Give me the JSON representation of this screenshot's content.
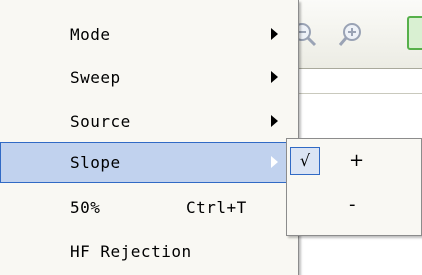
{
  "menu": {
    "items": [
      {
        "label": "Mode",
        "shortcut": "",
        "has_submenu": true
      },
      {
        "label": "Sweep",
        "shortcut": "",
        "has_submenu": true
      },
      {
        "label": "Source",
        "shortcut": "",
        "has_submenu": true
      },
      {
        "label": "Slope",
        "shortcut": "",
        "has_submenu": true,
        "highlighted": true
      },
      {
        "label": "50%",
        "shortcut": "Ctrl+T",
        "has_submenu": false
      },
      {
        "label": "HF Rejection",
        "shortcut": "",
        "has_submenu": false
      }
    ]
  },
  "submenu": {
    "items": [
      {
        "label": "+",
        "checked": true,
        "check_glyph": "√"
      },
      {
        "label": "-",
        "checked": false,
        "check_glyph": ""
      }
    ]
  },
  "toolbar": {
    "icons": [
      "zoom-out-icon",
      "zoom-in-icon",
      "green-button-icon"
    ]
  },
  "colors": {
    "highlight_bg": "#c1d2ee",
    "highlight_border": "#316ac5",
    "menu_bg": "#f9f8f3"
  }
}
